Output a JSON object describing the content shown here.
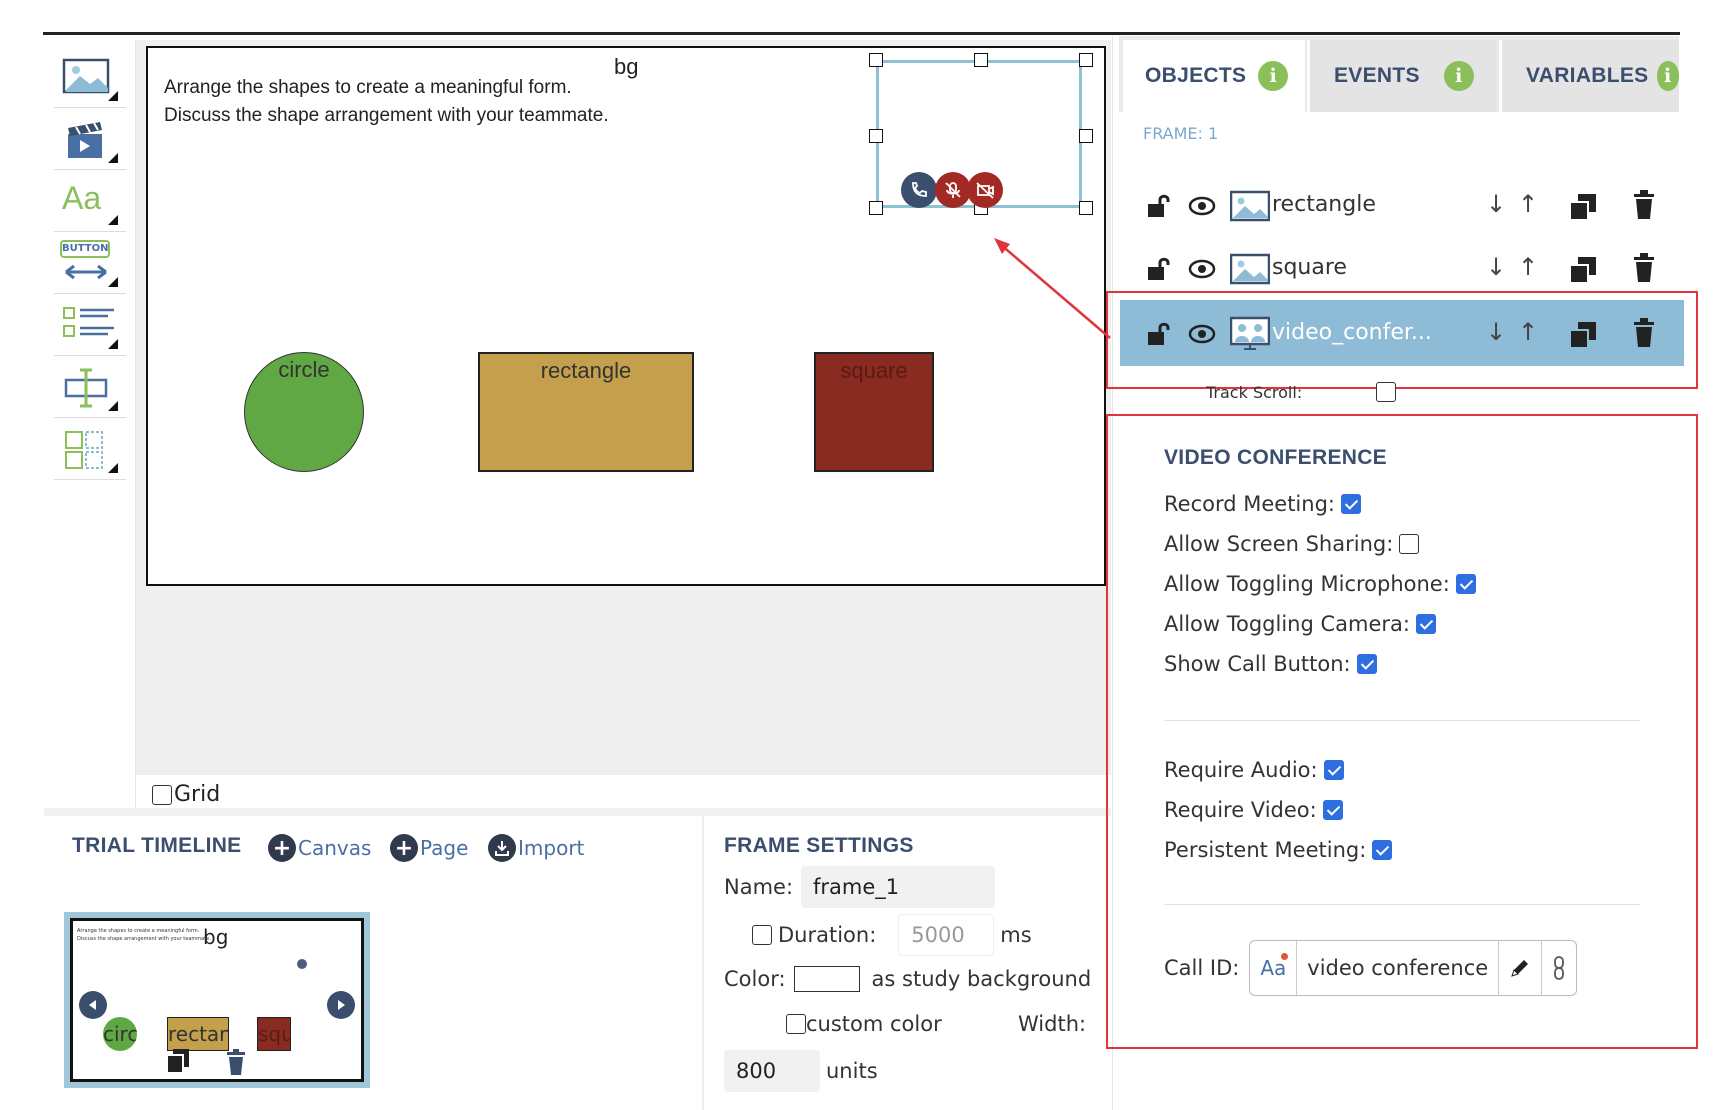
{
  "toolbar": {
    "tools": [
      "image-tool",
      "video-tool",
      "text-tool",
      "button-tool",
      "list-tool",
      "input-tool",
      "layout-tool"
    ],
    "button_tool_text": "BUTTON",
    "text_tool_text": "Aa"
  },
  "stage": {
    "instructions_line1": "Arrange the shapes to create a meaningful form.",
    "instructions_line2": "Discuss the shape arrangement with your teammate.",
    "bg_label": "bg",
    "circle_label": "circle",
    "rectangle_label": "rectangle",
    "square_label": "square",
    "colors": {
      "circle": "#5fa843",
      "rectangle": "#c49f4c",
      "square": "#8a2b22",
      "video_border": "#8ec2d3"
    }
  },
  "grid": {
    "label": "Grid",
    "checked": false
  },
  "timeline": {
    "title": "TRIAL TIMELINE",
    "canvas_label": "Canvas",
    "page_label": "Page",
    "import_label": "Import",
    "thumb": {
      "line1": "Arrange the shapes to create a meaningful form.",
      "line2": "Discuss the shape arrangement with your teammate.",
      "bg": "bg",
      "circle": "circ",
      "rectangle": "rectan",
      "square": "squ"
    }
  },
  "frame_settings": {
    "title": "FRAME SETTINGS",
    "name_label": "Name:",
    "name_value": "frame_1",
    "duration_label": "Duration:",
    "duration_value": "5000",
    "duration_unit": "ms",
    "color_label": "Color:",
    "as_study_bg": "as study background",
    "custom_color": "custom color",
    "width_label": "Width:",
    "width_value": "800",
    "width_unit": "units"
  },
  "right_panel": {
    "tabs": {
      "objects": "OBJECTS",
      "events": "EVENTS",
      "variables": "VARIABLES"
    },
    "frame_label": "FRAME: 1",
    "objects": [
      {
        "name": "rectangle"
      },
      {
        "name": "square"
      },
      {
        "name": "video_confer..."
      }
    ],
    "track_scroll": "Track Scroll:",
    "video_conference": {
      "title": "VIDEO CONFERENCE",
      "record_meeting": "Record Meeting:",
      "allow_screen_sharing": "Allow Screen Sharing:",
      "allow_toggling_microphone": "Allow Toggling Microphone:",
      "allow_toggling_camera": "Allow Toggling Camera:",
      "show_call_button": "Show Call Button:",
      "require_audio": "Require Audio:",
      "require_video": "Require Video:",
      "persistent_meeting": "Persistent Meeting:",
      "call_id_label": "Call ID:",
      "call_id_type": "Aa",
      "call_id_value": "video conference"
    }
  }
}
